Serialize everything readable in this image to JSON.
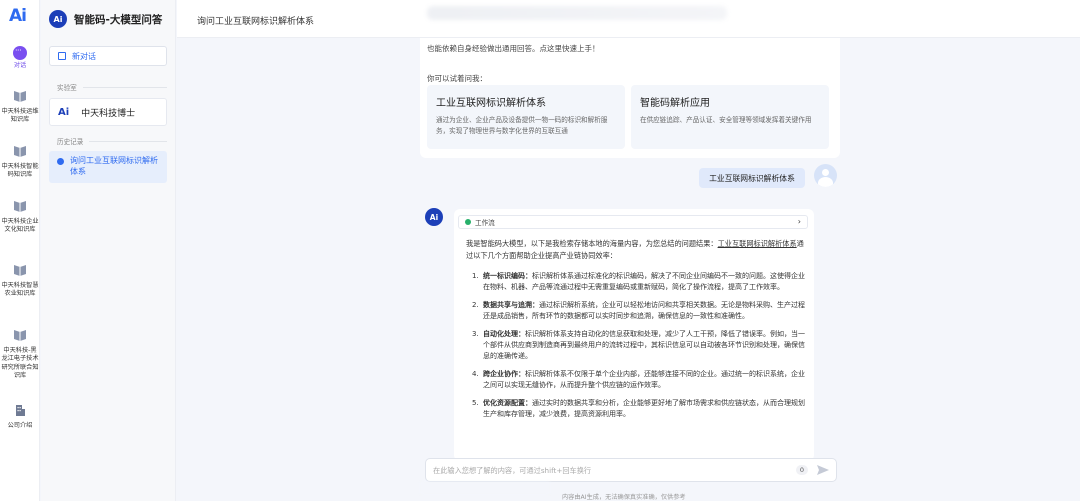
{
  "rail": {
    "logo": "Ai",
    "items": [
      {
        "label": "对话"
      },
      {
        "label": "中天科技运维知识库"
      },
      {
        "label": "中天科技智能码知识库"
      },
      {
        "label": "中天科技企业文化知识库"
      },
      {
        "label": "中天科技智慧农业知识库"
      },
      {
        "label": "中天科技-黑龙江电子技术研究所联合知识库"
      },
      {
        "label": "公司介绍"
      }
    ]
  },
  "sidebar": {
    "logo": "Ai",
    "title": "智能码-大模型问答",
    "new_chat": "新对话",
    "lab_section": "实验室",
    "lab_item": "中天科技博士",
    "history_section": "历史记录",
    "history_item": "询问工业互联网标识解析体系"
  },
  "header": {
    "title": "询问工业互联网标识解析体系"
  },
  "welcome": {
    "intro": "也能依赖自身经验做出通用回答。点这里快速上手！",
    "suggest_label": "你可以试着问我：",
    "cards": [
      {
        "title": "工业互联网标识解析体系",
        "desc": "通过为企业、企业产品及设备提供一物一码的标识和解析服务，实现了物理世界与数字化世界的互联互通"
      },
      {
        "title": "智能码解析应用",
        "desc": "在供应链追踪、产品认证、安全管理等领域发挥着关键作用"
      }
    ]
  },
  "user_message": "工业互联网标识解析体系",
  "answer": {
    "avatar": "Ai",
    "workflow": "工作流",
    "lead_prefix": "我是智能码大模型，以下是我检索存储本地的海量内容，为您总结的问题结果：",
    "lead_link": "工业互联网标识解析体系",
    "lead_suffix": "通过以下几个方面帮助企业提高产业链协同效率：",
    "points": [
      {
        "n": "1.",
        "title": "统一标识编码：",
        "text": "标识解析体系通过标准化的标识编码，解决了不同企业间编码不一致的问题。这使得企业在物料、机器、产品等流通过程中无需重复编码或重新赋码，简化了操作流程，提高了工作效率。"
      },
      {
        "n": "2.",
        "title": "数据共享与追溯：",
        "text": "通过标识解析系统，企业可以轻松地访问和共享相关数据。无论是物料采购、生产过程还是成品销售，所有环节的数据都可以实时同步和追溯，确保信息的一致性和准确性。"
      },
      {
        "n": "3.",
        "title": "自动化处理：",
        "text": "标识解析体系支持自动化的信息获取和处理，减少了人工干预，降低了错误率。例如，当一个部件从供应商到制造商再到最终用户的流转过程中，其标识信息可以自动被各环节识别和处理，确保信息的准确传递。"
      },
      {
        "n": "4.",
        "title": "跨企业协作：",
        "text": "标识解析体系不仅限于单个企业内部，还能够连接不同的企业。通过统一的标识系统，企业之间可以实现无缝协作，从而提升整个供应链的运作效率。"
      },
      {
        "n": "5.",
        "title": "优化资源配置：",
        "text": "通过实时的数据共享和分析，企业能够更好地了解市场需求和供应链状态，从而合理规划生产和库存管理，减少浪费，提高资源利用率。"
      }
    ]
  },
  "composer": {
    "placeholder": "在此输入您想了解的内容，可通过shift+回车换行",
    "count": "0"
  },
  "disclaimer": "内容由AI生成，无法确保真实准确，仅供参考",
  "colors": {
    "accent": "#2f6bf0",
    "brand": "#1c3fb8",
    "rail_active": "#7a4ff0"
  }
}
